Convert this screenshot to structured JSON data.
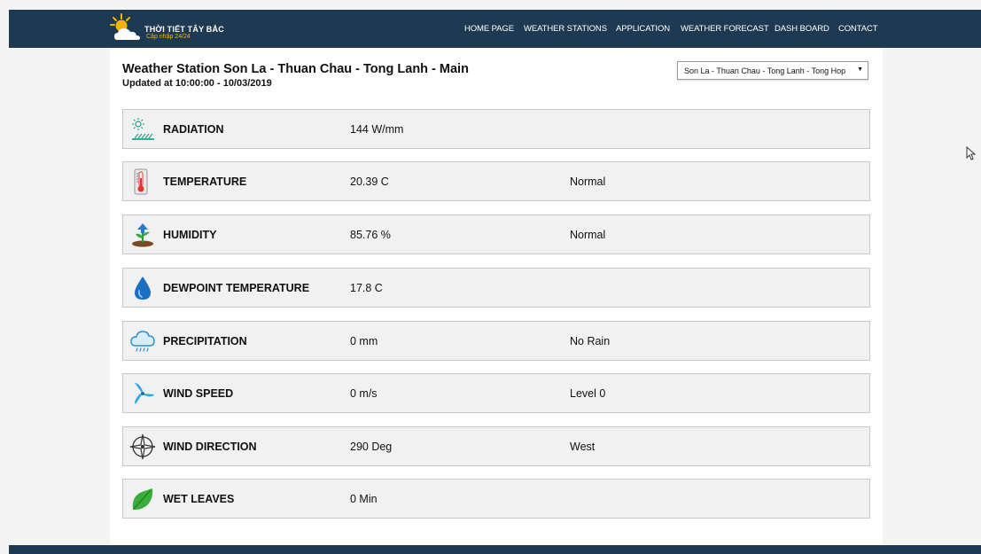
{
  "header": {
    "logo_title": "THỜI TIẾT TÂY BẮC",
    "logo_subtitle": "Cập nhập 24/24",
    "nav": [
      {
        "label": "HOME PAGE"
      },
      {
        "label": "WEATHER STATIONS"
      },
      {
        "label": "APPLICATION"
      },
      {
        "label": "WEATHER FORECAST"
      },
      {
        "label": "DASH BOARD"
      },
      {
        "label": "CONTACT"
      }
    ]
  },
  "station": {
    "title": "Weather Station Son La - Thuan Chau - Tong Lanh - Main",
    "updated": "Updated at 10:00:00 - 10/03/2019",
    "selected": "Son La - Thuan Chau - Tong Lanh - Tong Hop"
  },
  "measurements": [
    {
      "label": "RADIATION",
      "value": "144 W/mm",
      "status": "",
      "icon": "sun-radiation-icon"
    },
    {
      "label": "TEMPERATURE",
      "value": "20.39 C",
      "status": "Normal",
      "icon": "thermometer-icon"
    },
    {
      "label": "HUMIDITY",
      "value": "85.76 %",
      "status": "Normal",
      "icon": "plant-humidity-icon"
    },
    {
      "label": "DEWPOINT TEMPERATURE",
      "value": "17.8 C",
      "status": "",
      "icon": "water-drop-icon"
    },
    {
      "label": "PRECIPITATION",
      "value": "0 mm",
      "status": "No Rain",
      "icon": "rain-cloud-icon"
    },
    {
      "label": "WIND SPEED",
      "value": "0 m/s",
      "status": "Level 0",
      "icon": "wind-turbine-icon"
    },
    {
      "label": "WIND DIRECTION",
      "value": "290 Deg",
      "status": "West",
      "icon": "compass-icon"
    },
    {
      "label": "WET LEAVES",
      "value": "0 Min",
      "status": "",
      "icon": "leaf-icon"
    }
  ],
  "colors": {
    "header_bg": "#1e3a52",
    "row_bg": "#f1f1f1",
    "logo_accent": "#f5b400"
  }
}
